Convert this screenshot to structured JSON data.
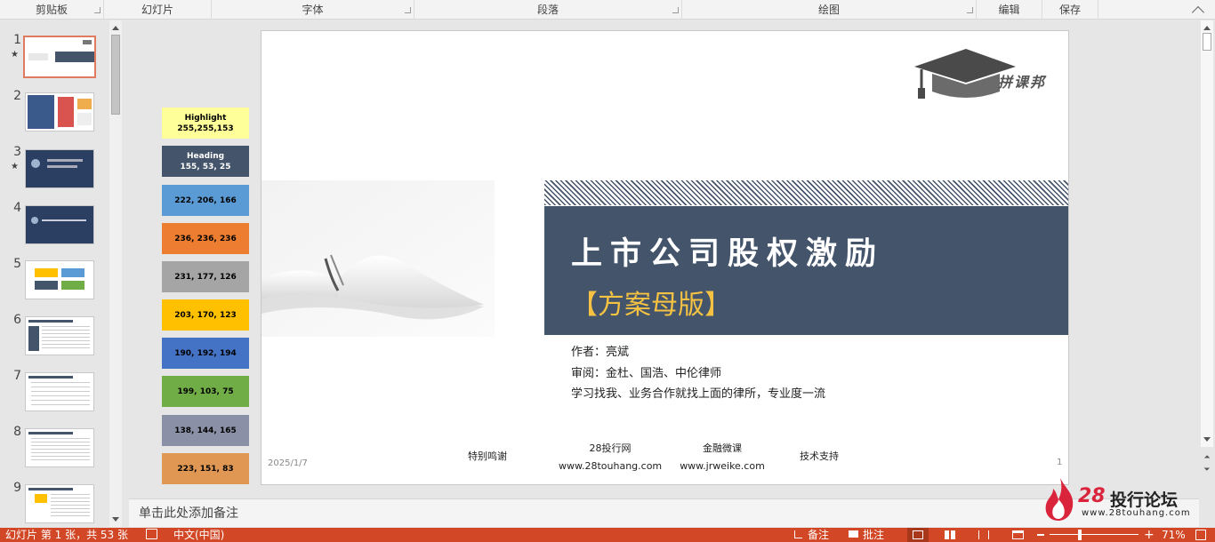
{
  "ribbon": {
    "groups": [
      "剪贴板",
      "幻灯片",
      "字体",
      "段落",
      "绘图",
      "编辑",
      "保存"
    ]
  },
  "thumbnails": [
    {
      "number": "1",
      "star": "★"
    },
    {
      "number": "2",
      "star": ""
    },
    {
      "number": "3",
      "star": "★"
    },
    {
      "number": "4",
      "star": ""
    },
    {
      "number": "5",
      "star": ""
    },
    {
      "number": "6",
      "star": ""
    },
    {
      "number": "7",
      "star": ""
    },
    {
      "number": "8",
      "star": ""
    },
    {
      "number": "9",
      "star": ""
    }
  ],
  "swatches": [
    {
      "line1": "Highlight",
      "line2": "255,255,153",
      "color": "#ffff99",
      "text_color": "#000000"
    },
    {
      "line1": "Heading",
      "line2": "155, 53, 25",
      "color": "#44546a",
      "text_color": "#ffffff"
    },
    {
      "line1": "",
      "line2": "222, 206, 166",
      "color": "#5b9bd5",
      "text_color": "#000000"
    },
    {
      "line1": "",
      "line2": "236, 236, 236",
      "color": "#ed7d31",
      "text_color": "#000000"
    },
    {
      "line1": "",
      "line2": "231, 177, 126",
      "color": "#a5a5a5",
      "text_color": "#000000"
    },
    {
      "line1": "",
      "line2": "203, 170, 123",
      "color": "#ffc000",
      "text_color": "#000000"
    },
    {
      "line1": "",
      "line2": "190, 192, 194",
      "color": "#4472c4",
      "text_color": "#000000"
    },
    {
      "line1": "",
      "line2": "199, 103, 75",
      "color": "#70ad47",
      "text_color": "#000000"
    },
    {
      "line1": "",
      "line2": "138, 144, 165",
      "color": "#8a90a5",
      "text_color": "#000000"
    },
    {
      "line1": "",
      "line2": "223, 151, 83",
      "color": "#df9753",
      "text_color": "#000000"
    }
  ],
  "slide": {
    "logo_text": "拼课邦",
    "title": "上市公司股权激励",
    "subtitle": "【方案母版】",
    "author": "作者：亮斌",
    "reviewer": "审阅：金杜、国浩、中伦律师",
    "tagline": "学习找我、业务合作就找上面的律所，专业度一流",
    "footer_date": "2025/1/7",
    "footer_thanks": "特别鸣谢",
    "footer_site1_name": "28投行网",
    "footer_site1_url": "www.28touhang.com",
    "footer_site2_name": "金融微课",
    "footer_site2_url": "www.jrweike.com",
    "footer_support": "技术支持",
    "page_number": "1",
    "title_band_color": "#44546a",
    "subtitle_color": "#f5c242"
  },
  "notes": {
    "placeholder": "单击此处添加备注"
  },
  "watermark": {
    "number": "28",
    "text": "投行论坛",
    "url": "www.28touhang.com"
  },
  "status": {
    "slide_info": "幻灯片 第 1 张，共 53 张",
    "language": "中文(中国)",
    "notes_button": "备注",
    "comments_button": "批注",
    "zoom": "71%"
  },
  "colors": {
    "status_bar": "#d24726",
    "accent": "#e07b62"
  }
}
